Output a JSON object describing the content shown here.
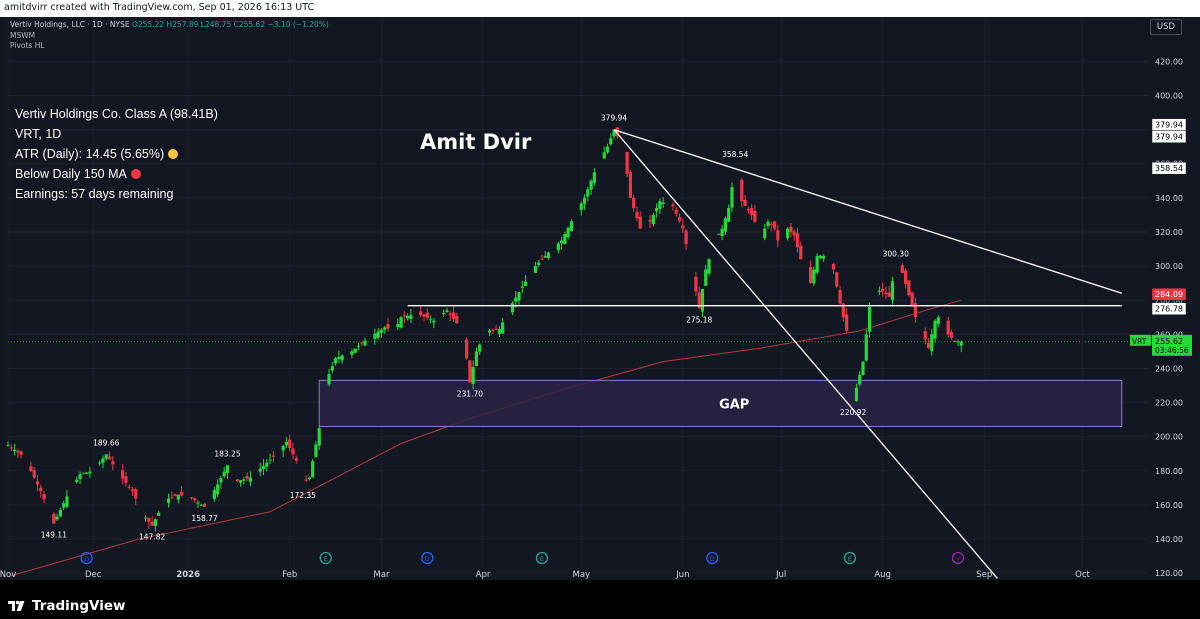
{
  "header": {
    "title": "amitdvirr created with TradingView.com, Sep 01, 2026 16:13 UTC"
  },
  "legend": {
    "symbol": "Vertiv Holdings, LLC · 1D · NYSE",
    "open": "O255.22",
    "high": "H257.89",
    "low": "L248.75",
    "close": "C255.62",
    "change": "−3.10 (−1.20%)",
    "indicators": [
      "MSWM",
      "Pivots HL"
    ]
  },
  "info_panel": {
    "line1": "Vertiv Holdings Co. Class A (98.41B)",
    "line2": "VRT, 1D",
    "line3": "ATR (Daily): 14.45 (5.65%)",
    "line4": "Below Daily 150 MA",
    "line5": "Earnings: 57 days remaining",
    "atr_dot_color": "#f5c542",
    "ma_dot_color": "#f23645"
  },
  "author": "Amit Dvir",
  "currency": "USD",
  "colors": {
    "background": "#131722",
    "up": "#26d93a",
    "down": "#f23645",
    "ma": "#b23a3a",
    "gap_fill": "#2a2347",
    "gap_border": "#8e7cc3",
    "trendline": "#ffffff"
  },
  "chart_data": {
    "type": "candlestick",
    "symbol": "VRT",
    "timeframe": "1D",
    "y_axis": {
      "ticks": [
        120,
        140,
        160,
        180,
        200,
        220,
        240,
        260,
        280,
        300,
        320,
        340,
        360,
        380,
        400,
        420
      ],
      "ylim": [
        116,
        446
      ]
    },
    "x_axis": {
      "labels": [
        "Nov",
        "Dec",
        "2026",
        "Feb",
        "Mar",
        "Apr",
        "May",
        "Jun",
        "Jul",
        "Aug",
        "Sep",
        "Oct"
      ],
      "label_days": [
        0,
        26,
        55,
        86,
        114,
        145,
        175,
        206,
        236,
        267,
        298,
        328
      ],
      "xlim": [
        0,
        348
      ]
    },
    "price_path": [
      [
        0,
        195
      ],
      [
        5,
        188
      ],
      [
        10,
        168
      ],
      [
        14,
        149.11
      ],
      [
        18,
        165
      ],
      [
        22,
        178
      ],
      [
        26,
        180
      ],
      [
        30,
        189.66
      ],
      [
        34,
        178
      ],
      [
        38,
        168
      ],
      [
        41,
        155
      ],
      [
        44,
        147.82
      ],
      [
        48,
        163
      ],
      [
        52,
        166
      ],
      [
        56,
        164
      ],
      [
        60,
        158.77
      ],
      [
        64,
        172
      ],
      [
        67,
        183.25
      ],
      [
        70,
        174
      ],
      [
        74,
        176
      ],
      [
        78,
        183
      ],
      [
        82,
        190
      ],
      [
        85,
        197
      ],
      [
        88,
        186
      ],
      [
        90,
        172.35
      ],
      [
        92,
        176
      ],
      [
        95,
        205
      ],
      [
        97,
        232
      ],
      [
        100,
        246
      ],
      [
        105,
        250
      ],
      [
        110,
        258
      ],
      [
        115,
        264
      ],
      [
        118,
        262
      ],
      [
        120,
        270
      ],
      [
        125,
        272
      ],
      [
        130,
        268
      ],
      [
        134,
        274
      ],
      [
        138,
        264
      ],
      [
        140,
        246
      ],
      [
        141,
        231.7
      ],
      [
        143,
        250
      ],
      [
        146,
        262
      ],
      [
        150,
        263
      ],
      [
        153,
        275
      ],
      [
        157,
        288
      ],
      [
        161,
        300
      ],
      [
        165,
        308
      ],
      [
        169,
        315
      ],
      [
        173,
        330
      ],
      [
        176,
        340
      ],
      [
        180,
        360
      ],
      [
        183,
        370
      ],
      [
        185,
        379.94
      ],
      [
        188,
        368
      ],
      [
        190,
        340
      ],
      [
        193,
        322
      ],
      [
        196,
        326
      ],
      [
        199,
        338
      ],
      [
        203,
        335
      ],
      [
        206,
        322
      ],
      [
        209,
        295
      ],
      [
        211,
        275.18
      ],
      [
        213,
        298
      ],
      [
        216,
        316
      ],
      [
        218,
        322
      ],
      [
        220,
        334
      ],
      [
        222,
        358.54
      ],
      [
        224,
        338
      ],
      [
        227,
        330
      ],
      [
        230,
        318
      ],
      [
        232,
        326
      ],
      [
        234,
        322
      ],
      [
        236,
        308
      ],
      [
        238,
        322
      ],
      [
        240,
        318
      ],
      [
        242,
        304
      ],
      [
        244,
        298
      ],
      [
        245,
        290
      ],
      [
        247,
        306
      ],
      [
        250,
        306
      ],
      [
        252,
        298
      ],
      [
        254,
        278
      ],
      [
        256,
        262
      ],
      [
        258,
        220.92
      ],
      [
        261,
        244
      ],
      [
        263,
        276
      ],
      [
        265,
        286
      ],
      [
        267,
        285
      ],
      [
        269,
        282
      ],
      [
        271,
        300.3
      ],
      [
        273,
        296
      ],
      [
        275,
        283
      ],
      [
        277,
        270
      ],
      [
        279,
        262
      ],
      [
        281,
        252
      ],
      [
        283,
        268
      ],
      [
        285,
        272
      ],
      [
        287,
        260
      ],
      [
        289,
        256
      ],
      [
        291,
        255.62
      ]
    ],
    "ma150_path": [
      [
        0,
        118
      ],
      [
        40,
        140
      ],
      [
        80,
        156
      ],
      [
        100,
        176
      ],
      [
        120,
        196
      ],
      [
        140,
        210
      ],
      [
        170,
        228
      ],
      [
        200,
        244
      ],
      [
        230,
        252
      ],
      [
        260,
        262
      ],
      [
        280,
        274
      ],
      [
        291,
        280
      ]
    ],
    "current": {
      "price": "255.62",
      "countdown": "03:46:56",
      "symbol_tag": "VRT"
    },
    "price_tags": [
      "379.94",
      "379.94",
      "358.54",
      "284.09",
      "276.78"
    ],
    "pivot_labels": [
      {
        "day": 14,
        "price": 149.11,
        "text": "149.11",
        "pos": "below"
      },
      {
        "day": 30,
        "price": 189.66,
        "text": "189.66",
        "pos": "above"
      },
      {
        "day": 44,
        "price": 147.82,
        "text": "147.82",
        "pos": "below"
      },
      {
        "day": 60,
        "price": 158.77,
        "text": "158.77",
        "pos": "below"
      },
      {
        "day": 67,
        "price": 183.25,
        "text": "183.25",
        "pos": "above"
      },
      {
        "day": 90,
        "price": 172.35,
        "text": "172.35",
        "pos": "below"
      },
      {
        "day": 141,
        "price": 231.7,
        "text": "231.70",
        "pos": "below"
      },
      {
        "day": 185,
        "price": 379.94,
        "text": "379.94",
        "pos": "above"
      },
      {
        "day": 211,
        "price": 275.18,
        "text": "275.18",
        "pos": "below"
      },
      {
        "day": 222,
        "price": 358.54,
        "text": "358.54",
        "pos": "above"
      },
      {
        "day": 258,
        "price": 220.92,
        "text": "220.92",
        "pos": "below"
      },
      {
        "day": 271,
        "price": 300.3,
        "text": "300.30",
        "pos": "above"
      }
    ],
    "gap_zone": {
      "x0": 95,
      "x1": 340,
      "y_low": 206,
      "y_high": 233,
      "label": "GAP"
    },
    "support_line": {
      "x0": 122,
      "x1": 340,
      "price": 276.78
    },
    "trendlines": [
      {
        "x0": 185,
        "y0": 379.94,
        "x1": 340,
        "y1": 284.09
      },
      {
        "x0": 185,
        "y0": 379.94,
        "x1": 302,
        "y1": 117
      }
    ],
    "event_markers": [
      {
        "day": 24,
        "type": "D"
      },
      {
        "day": 97,
        "type": "E"
      },
      {
        "day": 128,
        "type": "D"
      },
      {
        "day": 163,
        "type": "E"
      },
      {
        "day": 215,
        "type": "D"
      },
      {
        "day": 257,
        "type": "E"
      },
      {
        "day": 290,
        "type": "S"
      }
    ]
  },
  "branding": {
    "name": "TradingView"
  }
}
